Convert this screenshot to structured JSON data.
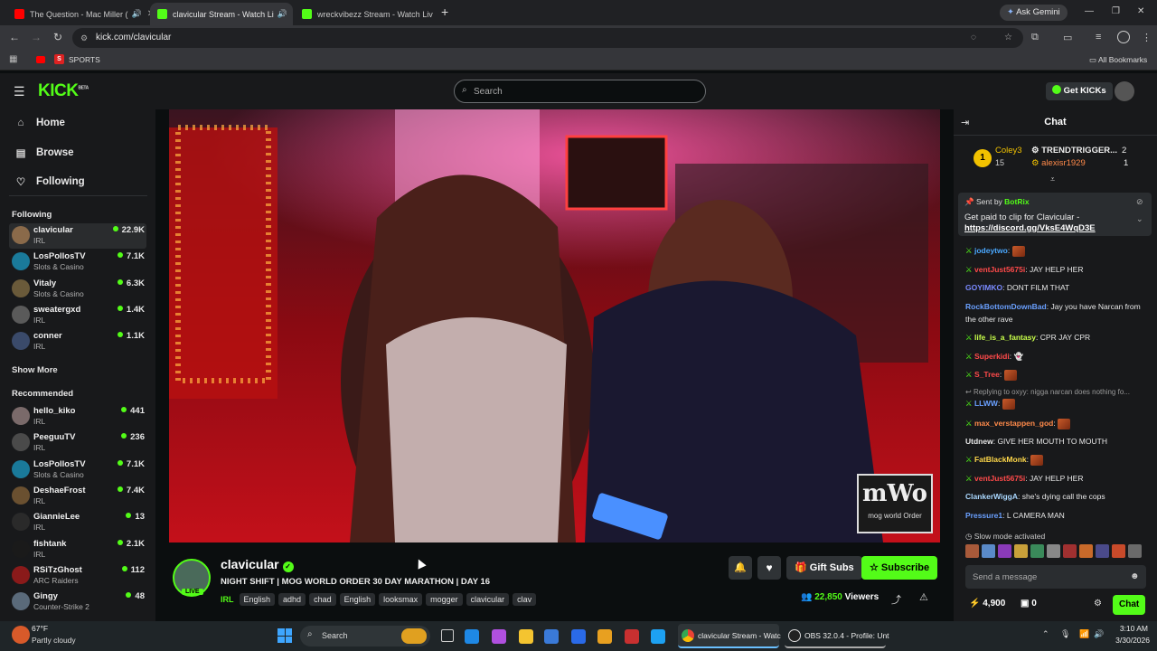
{
  "browser": {
    "tabs": [
      {
        "title": "The Question - Mac Miller (",
        "color": "#ff0000"
      },
      {
        "title": "clavicular Stream - Watch Li",
        "color": "#53fc18"
      },
      {
        "title": "wreckvibezz Stream - Watch Liv",
        "color": "#53fc18"
      }
    ],
    "ask_gemini": "Ask Gemini",
    "url": "kick.com/clavicular",
    "bookmark_sports": "SPORTS",
    "all_bookmarks": "All Bookmarks"
  },
  "site": {
    "logo": "KICK",
    "logo_beta": "BETA",
    "search_placeholder": "Search",
    "get_kicks": "Get KICKs"
  },
  "sidebar": {
    "nav": [
      {
        "label": "Home",
        "icon": "home-icon"
      },
      {
        "label": "Browse",
        "icon": "browse-icon"
      },
      {
        "label": "Following",
        "icon": "heart-icon"
      }
    ],
    "following_title": "Following",
    "following": [
      {
        "name": "clavicular",
        "category": "IRL",
        "viewers": "22.9K",
        "color": "#8a6a4a"
      },
      {
        "name": "LosPollosTV",
        "category": "Slots & Casino",
        "viewers": "7.1K",
        "color": "#1a7a9a"
      },
      {
        "name": "Vitaly",
        "category": "Slots & Casino",
        "viewers": "6.3K",
        "color": "#6a5a3a"
      },
      {
        "name": "sweatergxd",
        "category": "IRL",
        "viewers": "1.4K",
        "color": "#5a5a5a"
      },
      {
        "name": "conner",
        "category": "IRL",
        "viewers": "1.1K",
        "color": "#3a4a6a"
      }
    ],
    "show_more": "Show More",
    "recommended_title": "Recommended",
    "recommended": [
      {
        "name": "hello_kiko",
        "category": "IRL",
        "viewers": "441",
        "color": "#7a6a6a"
      },
      {
        "name": "PeeguuTV",
        "category": "IRL",
        "viewers": "236",
        "color": "#4a4a4a"
      },
      {
        "name": "LosPollosTV",
        "category": "Slots & Casino",
        "viewers": "7.1K",
        "color": "#1a7a9a"
      },
      {
        "name": "DeshaeFrost",
        "category": "IRL",
        "viewers": "7.4K",
        "color": "#6a5030"
      },
      {
        "name": "GiannieLee",
        "category": "IRL",
        "viewers": "13",
        "color": "#2a2a2a"
      },
      {
        "name": "fishtank",
        "category": "IRL",
        "viewers": "2.1K",
        "color": "#1a1a1a"
      },
      {
        "name": "RSiTzGhost",
        "category": "ARC Raiders",
        "viewers": "112",
        "color": "#8a1a1a"
      },
      {
        "name": "Gingy",
        "category": "Counter-Strike 2",
        "viewers": "48",
        "color": "#5a6a7a"
      }
    ]
  },
  "stream": {
    "watermark_text": "mWo",
    "watermark_sub": "mog world Order",
    "streamer": "clavicular",
    "live_badge": "LIVE",
    "title": "NIGHT SHIFT | MOG WORLD ORDER 30 DAY MARATHON | DAY 16",
    "category": "IRL",
    "tags": [
      "English",
      "adhd",
      "chad",
      "English",
      "looksmax",
      "mogger",
      "clavicular",
      "clav"
    ],
    "gift_subs": "Gift Subs",
    "subscribe": "Subscribe",
    "viewers": "22,850",
    "viewers_label": "Viewers"
  },
  "chat": {
    "title": "Chat",
    "leader1_name": "Coley3",
    "leader1_rank": "1",
    "leader1_count": "15",
    "leader2_name": "TRENDTRIGGER...",
    "leader2_count": "2",
    "leader3_name": "alexisr1929",
    "leader3_count": "1",
    "pinned_sent_by": "Sent by",
    "pinned_bot": "BotRix",
    "pinned_text": "Get paid to clip for Clavicular -",
    "pinned_link": "https://discord.gg/VksE4WqD3E",
    "messages": [
      {
        "user": "jodeytwo",
        "text": "",
        "color": "#4aa8ff",
        "emote": true
      },
      {
        "user": "ventJust5675i",
        "text": "JAY HELP HER",
        "color": "#ff4a4a",
        "emote": false
      },
      {
        "user": "GOYIMKO",
        "text": "DONT FILM THAT",
        "color": "#7a8aff",
        "emote": false
      },
      {
        "user": "RockBottomDownBad",
        "text": "Jay you have Narcan from the other rave",
        "color": "#6aa0ff",
        "emote": false
      },
      {
        "user": "life_is_a_fantasy",
        "text": "CPR JAY CPR",
        "color": "#c8ff4a",
        "emote": false
      },
      {
        "user": "Superkidi",
        "text": "👻",
        "color": "#ff4a4a",
        "emote": false
      },
      {
        "user": "S_Tree",
        "text": "",
        "color": "#ff4a4a",
        "emote": true
      },
      {
        "user": "LLWW",
        "text": "",
        "color": "#6aa0ff",
        "emote": true
      },
      {
        "user": "max_verstappen_god",
        "text": "",
        "color": "#ff8a4a",
        "emote": true
      },
      {
        "user": "Utdnew",
        "text": "GIVE HER MOUTH TO MOUTH",
        "color": "#e8e8e8",
        "emote": false
      },
      {
        "user": "FatBlackMonk",
        "text": "",
        "color": "#ffd84a",
        "emote": true
      },
      {
        "user": "ventJust5675i",
        "text": "JAY HELP HER",
        "color": "#ff4a4a",
        "emote": false
      },
      {
        "user": "ClankerWiggA",
        "text": "she's dying call the cops",
        "color": "#aad8ff",
        "emote": false
      },
      {
        "user": "Pressure1",
        "text": "L CAMERA MAN",
        "color": "#6aa0ff",
        "emote": false
      }
    ],
    "reply_text": "Replying to oxyy: nigga narcan does nothing fo...",
    "slow_mode": "Slow mode activated",
    "send_placeholder": "Send a message",
    "points": "4,900",
    "counter": "0",
    "chat_button": "Chat"
  },
  "taskbar": {
    "temp": "67°F",
    "weather": "Partly cloudy",
    "search": "Search",
    "app1": "clavicular Stream - Watc",
    "app2": "OBS 32.0.4 - Profile: Unt",
    "time": "3:10 AM",
    "date": "3/30/2026"
  }
}
